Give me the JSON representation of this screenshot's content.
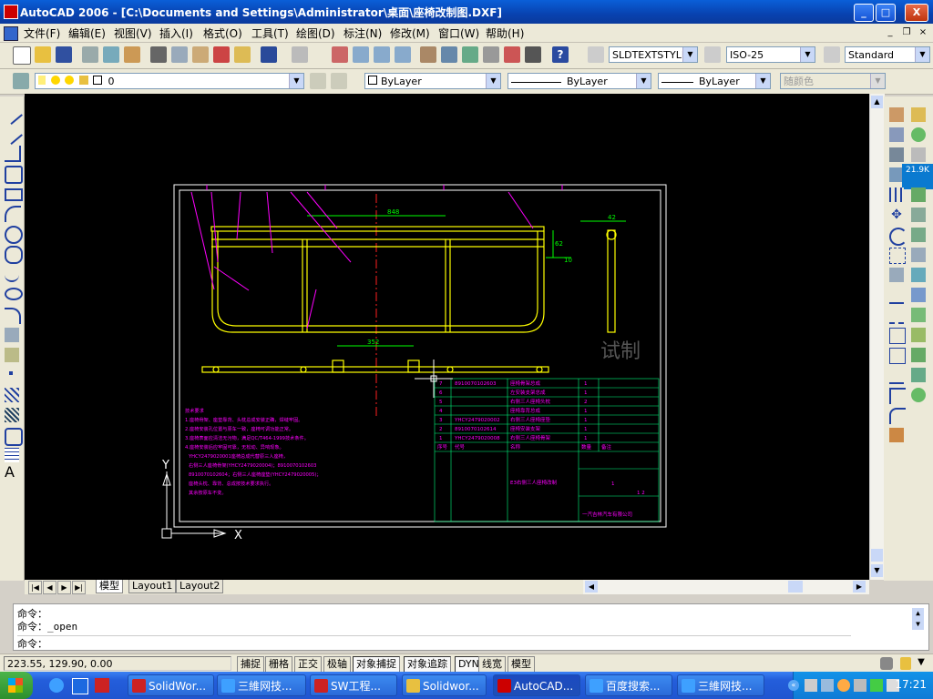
{
  "window": {
    "title": "AutoCAD 2006 - [C:\\Documents and Settings\\Administrator\\桌面\\座椅改制图.DXF]",
    "min": "_",
    "max": "□",
    "close": "X"
  },
  "menu": [
    "文件(F)",
    "编辑(E)",
    "视图(V)",
    "插入(I)",
    "格式(O)",
    "工具(T)",
    "绘图(D)",
    "标注(N)",
    "修改(M)",
    "窗口(W)",
    "帮助(H)"
  ],
  "toolbar": {
    "text_style": "SLDTEXTSTYLE0",
    "dim_style": "ISO-25",
    "table_style": "Standard",
    "layer": "0",
    "color": "ByLayer",
    "linetype": "ByLayer",
    "lineweight": "ByLayer",
    "plot_style": "随颜色"
  },
  "tabs": [
    "模型",
    "Layout1",
    "Layout2"
  ],
  "command": {
    "line1": "命令：",
    "line2": "命令：_open",
    "prompt": "命令："
  },
  "status": {
    "coords": "223.55, 129.90, 0.00",
    "buttons": [
      "捕捉",
      "栅格",
      "正交",
      "极轴",
      "对象捕捉",
      "对象追踪",
      "DYN",
      "线宽",
      "模型"
    ]
  },
  "drawing": {
    "dim_top": "848",
    "dim_bottom": "352",
    "dim_right1": "62",
    "dim_right2": "42",
    "dim_right3": "10",
    "watermark": "试制",
    "axis_x": "X",
    "axis_y": "Y",
    "part_rows": [
      {
        "no": "7",
        "code": "8910070102603",
        "name": "座椅骨架总成",
        "qty": "1"
      },
      {
        "no": "6",
        "code": "",
        "name": "左安装支架总成",
        "qty": "1"
      },
      {
        "no": "5",
        "code": "",
        "name": "右侧三人座椅头枕",
        "qty": "2"
      },
      {
        "no": "4",
        "code": "",
        "name": "座椅靠背总成",
        "qty": "1"
      },
      {
        "no": "3",
        "code": "YHCY2479020002",
        "name": "右侧三人座椅座垫",
        "qty": "1"
      },
      {
        "no": "2",
        "code": "8910070102614",
        "name": "座椅安装支架",
        "qty": "1"
      },
      {
        "no": "1",
        "code": "YHCY2479020008",
        "name": "右侧三人座椅骨架",
        "qty": "1"
      }
    ],
    "header_row": [
      "序号",
      "代号",
      "名称",
      "数量",
      "备注"
    ],
    "title_block_name": "E3右侧三人座椅改制",
    "company": "一汽吉林汽车有限公司",
    "sheet": "1",
    "sheet_of": "1 2",
    "notes_title": "技术要求",
    "notes": [
      "1.座椅骨架、座垫靠背、头枕总成安装正确，焊缝牢固。",
      "2.座椅安装孔位置与原车一致，座椅可调功能正常。",
      "3.座椅表面应清洁无污物，满足QC/T464-1999技术条件。",
      "4.座椅安装后应牢固可靠，无松动、异响现象。",
      "YHCY2479020001座椅总成代替原三人座椅，",
      "右侧三人座椅骨架(YHCY2479020004)；8910070102603",
      "8910070102604；右侧三人座椅座垫(YHCY2479020005)；",
      "座椅头枕、靠背、总成按技术要求执行。",
      "其余按原车不变。"
    ]
  }
}
